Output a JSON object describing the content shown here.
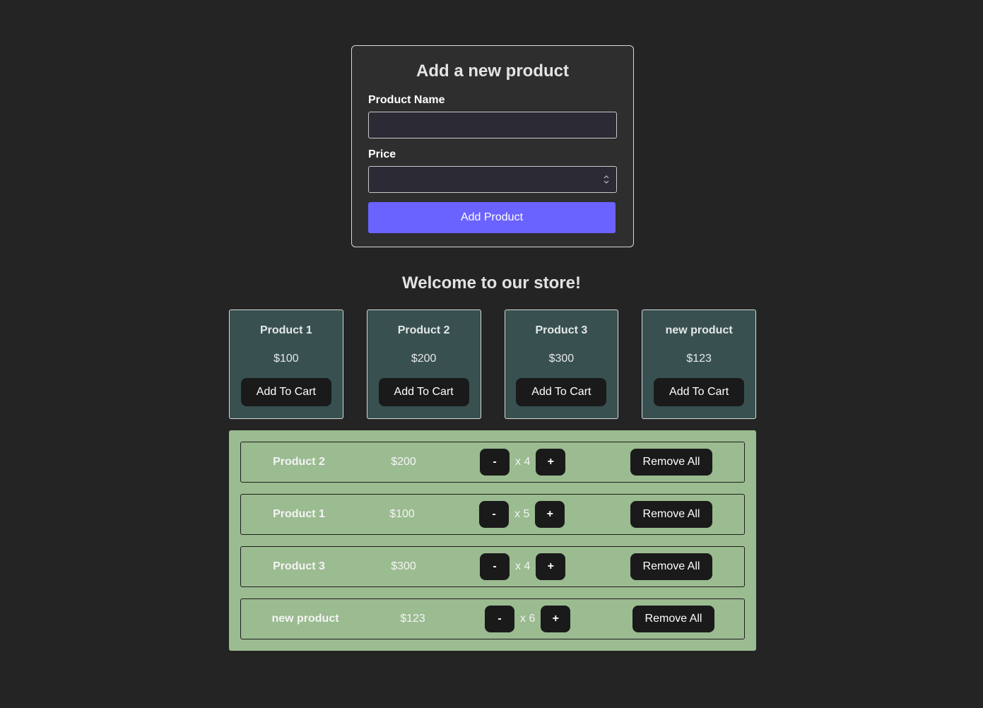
{
  "form": {
    "title": "Add a new product",
    "name_label": "Product Name",
    "name_value": "",
    "price_label": "Price",
    "price_value": "",
    "submit_label": "Add Product"
  },
  "store": {
    "title": "Welcome to our store!",
    "products": [
      {
        "name": "Product 1",
        "price": "$100",
        "button": "Add To Cart"
      },
      {
        "name": "Product 2",
        "price": "$200",
        "button": "Add To Cart"
      },
      {
        "name": "Product 3",
        "price": "$300",
        "button": "Add To Cart"
      },
      {
        "name": "new product",
        "price": "$123",
        "button": "Add To Cart"
      }
    ]
  },
  "cart": {
    "decrement_label": "-",
    "increment_label": "+",
    "remove_label": "Remove All",
    "items": [
      {
        "name": "Product 2",
        "price": "$200",
        "qty": "x 4"
      },
      {
        "name": "Product 1",
        "price": "$100",
        "qty": "x 5"
      },
      {
        "name": "Product 3",
        "price": "$300",
        "qty": "x 4"
      },
      {
        "name": "new product",
        "price": "$123",
        "qty": "x 6"
      }
    ]
  },
  "icons": {
    "price_spinner": "updown-chevron-icon"
  }
}
